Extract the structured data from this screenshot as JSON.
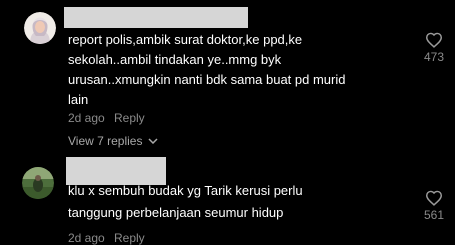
{
  "comments": [
    {
      "text": "report polis,ambik surat doktor,ke ppd,ke sekolah..ambil tindakan ye..mmg byk urusan..xmungkin nanti bdk sama buat pd murid lain",
      "time": "2d ago",
      "reply_label": "Reply",
      "like_count": "473",
      "view_replies_label": "View 7 replies"
    },
    {
      "text": "klu x sembuh budak yg Tarik kerusi perlu tanggung perbelanjaan seumur hidup",
      "time": "2d ago",
      "reply_label": "Reply",
      "like_count": "561"
    }
  ],
  "colors": {
    "background": "#000000",
    "text": "#ffffff",
    "muted": "#8a8a8a",
    "username_redaction": "#d6d6d6"
  },
  "icons": {
    "like": "heart-outline-icon",
    "expand": "chevron-down-icon"
  }
}
